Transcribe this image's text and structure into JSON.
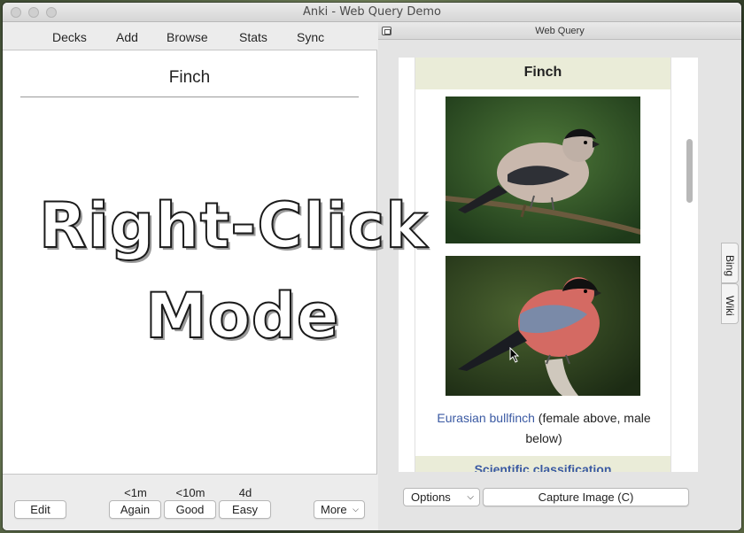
{
  "window": {
    "title": "Anki - Web Query Demo"
  },
  "toolbar": {
    "decks": "Decks",
    "add": "Add",
    "browse": "Browse",
    "stats": "Stats",
    "sync": "Sync"
  },
  "card": {
    "front": "Finch"
  },
  "overlay": {
    "line1": "Right-Click",
    "line2": "Mode"
  },
  "review": {
    "edit_label": "Edit",
    "intervals": {
      "again": "<1m",
      "good": "<10m",
      "easy": "4d"
    },
    "again_label": "Again",
    "good_label": "Good",
    "easy_label": "Easy",
    "more_label": "More"
  },
  "web_query": {
    "panel_title": "Web Query",
    "infobox_title": "Finch",
    "caption_link": "Eurasian bullfinch",
    "caption_text": " (female above, male below)",
    "section_partial": "Scientific classification",
    "tabs": [
      "Bing",
      "Wiki"
    ],
    "options_label": "Options",
    "capture_label": "Capture Image (C)"
  },
  "colors": {
    "accent_link": "#3b5aa3",
    "infobox_header": "#eaecd8"
  }
}
